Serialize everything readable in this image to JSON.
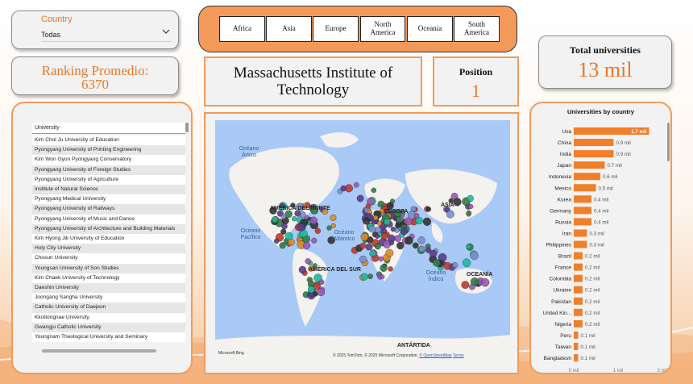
{
  "country_slicer": {
    "title": "Country",
    "selected": "Todas"
  },
  "continents": [
    "Africa",
    "Asia",
    "Europe",
    "North America",
    "Oceania",
    "South America"
  ],
  "ranking_card": {
    "label": "Ranking Promedio:",
    "value": "6370"
  },
  "university_name": "Massachusetts Institute of Technology",
  "position_card": {
    "label": "Position",
    "value": "1"
  },
  "total_card": {
    "label": "Total universities",
    "value": "13 mil"
  },
  "university_table": {
    "header": "University",
    "rows": [
      "Kim Chol Ju University of Education",
      "Pyongyang University of Printing Engineering",
      "Kim Won Gyun Pyongyang Conservatory",
      "Pyongyang University of Foreign Studies",
      "Pyongyang University of Agriculture",
      "Institute of Natural Science",
      "Pyongyang Medical University",
      "Pyongyang University of Railways",
      "Pyongyang University of Music and Dance",
      "Pyongyang University of Architecture and Building Materials",
      "Kim Hyong Jik University of Education",
      "Holy City University",
      "Chosun University",
      "Youngsan University of Son Studies",
      "Kim Chaek University of Technology",
      "Daeshin University",
      "Joongang Sangha University",
      "Catholic University of Daejeon",
      "Kkottongnae University",
      "Gwangju Catholic University",
      "Youngnam Theological University and Seminary"
    ]
  },
  "map": {
    "regions": [
      "AMÉRICA DEL NORTE",
      "ASIA",
      "EUROPA",
      "AMÉRICA DEL SUR",
      "OCEANÍA",
      "ANTÁRTIDA"
    ],
    "oceans": [
      "Océano Ártico",
      "Océano Pacífico",
      "Océano Atlántico",
      "Océano Índico"
    ],
    "logo_text": "Microsoft Bing",
    "copyright": "© 2025 TomTom, © 2025 Microsoft Corporation,",
    "osm_link": "© OpenStreetMap",
    "terms_link": "Terms"
  },
  "chart_data": {
    "type": "bar",
    "orientation": "horizontal",
    "title": "Universities by country",
    "categories": [
      "Usa",
      "China",
      "India",
      "Japan",
      "Indonesia",
      "Mexico",
      "Korea",
      "Germany",
      "Russia",
      "Iran",
      "Philippines",
      "Brazil",
      "France",
      "Colombia",
      "Ukraine",
      "Pakistan",
      "United Kin...",
      "Nigeria",
      "Peru",
      "Taiwan",
      "Bangladesh"
    ],
    "values": [
      1.7,
      0.9,
      0.9,
      0.7,
      0.6,
      0.5,
      0.4,
      0.4,
      0.4,
      0.3,
      0.3,
      0.2,
      0.2,
      0.2,
      0.2,
      0.2,
      0.2,
      0.2,
      0.1,
      0.1,
      0.1
    ],
    "value_labels": [
      "1.7 mil",
      "0.9 mil",
      "0.9 mil",
      "0.7 mil",
      "0.6 mil",
      "0.5 mil",
      "0.4 mil",
      "0.4 mil",
      "0.4 mil",
      "0.3 mil",
      "0.3 mil",
      "0.2 mil",
      "0.2 mil",
      "0.2 mil",
      "0.2 mil",
      "0.2 mil",
      "0.2 mil",
      "0.2 mil",
      "0.1 mil",
      "0.1 mil",
      "0.1 mil"
    ],
    "xlim": [
      0,
      2
    ],
    "x_ticks": [
      "0 mil",
      "1 mil",
      "2 mil"
    ],
    "bar_color": "#f07f2a"
  },
  "colors": {
    "accent": "#e8762a",
    "border": "#f39a5a",
    "bar": "#f07f2a"
  }
}
